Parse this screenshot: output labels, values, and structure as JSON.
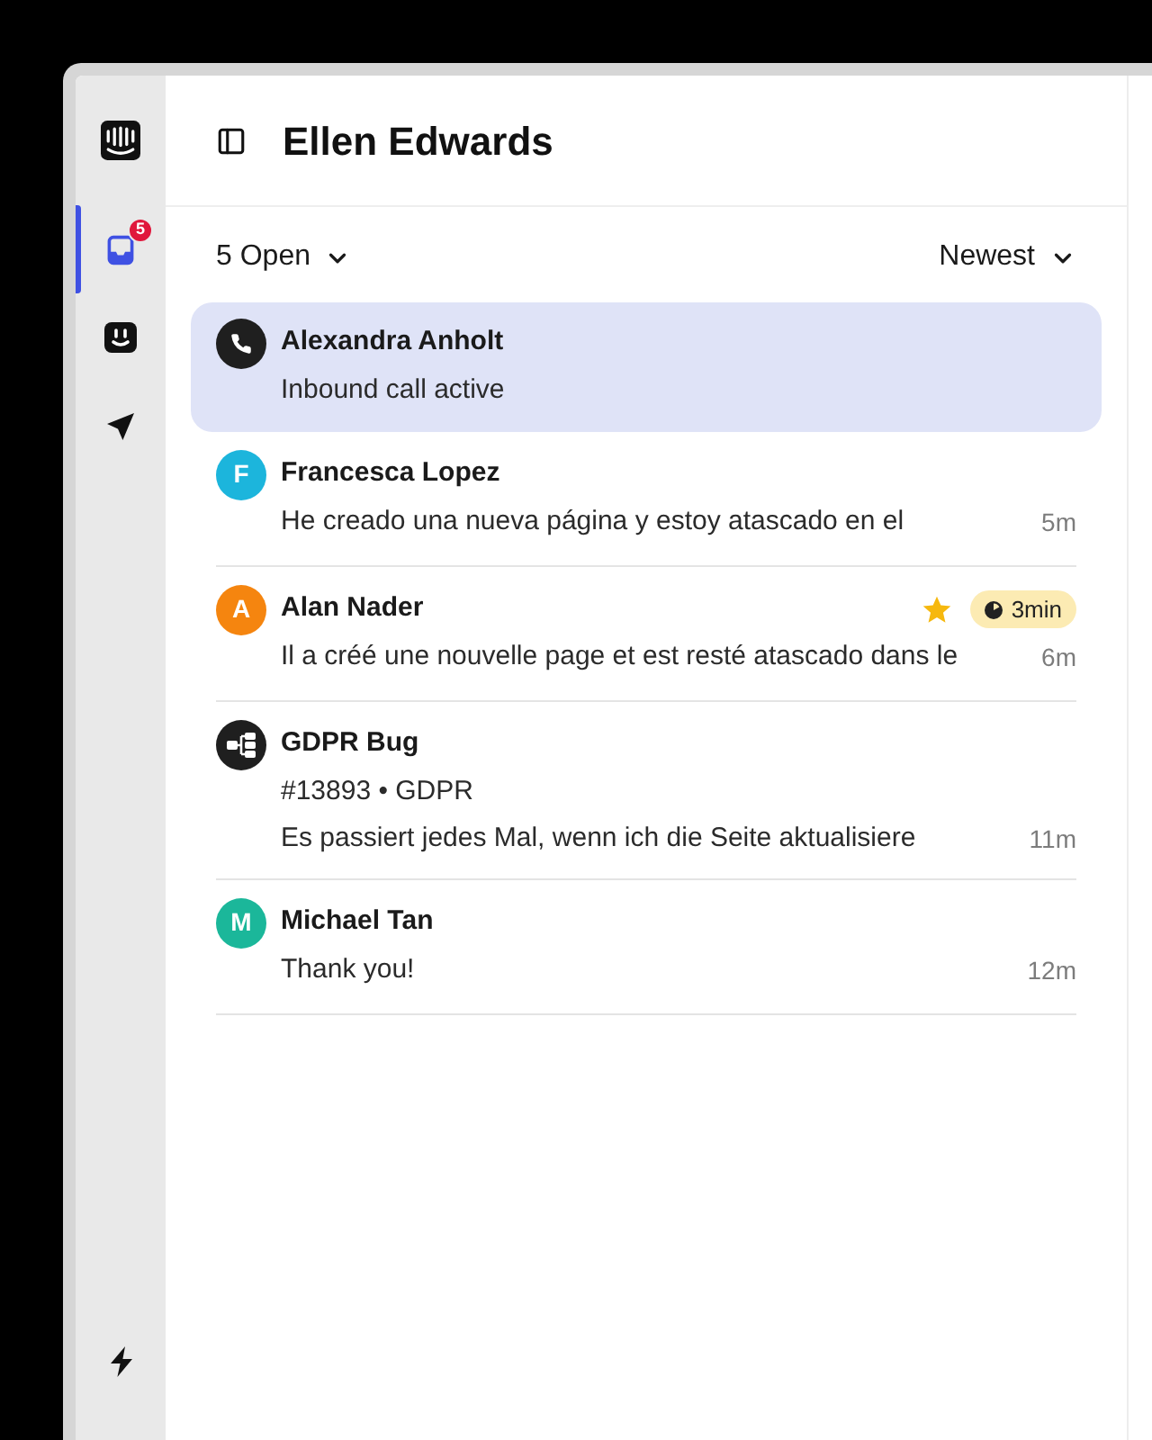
{
  "sidebar": {
    "items": [
      {
        "kind": "inbox",
        "selected": true,
        "badge": "5"
      },
      {
        "kind": "fin",
        "selected": false
      },
      {
        "kind": "send",
        "selected": false
      }
    ],
    "bottom_items": [
      {
        "kind": "bolt",
        "selected": false
      }
    ]
  },
  "header": {
    "title": "Ellen Edwards"
  },
  "filters": {
    "status": "5 Open",
    "sort": "Newest"
  },
  "conversations": [
    {
      "avatar": {
        "kind": "phone"
      },
      "name": "Alexandra Anholt",
      "starred": false,
      "lines": [
        "Inbound call active"
      ],
      "selected": true
    },
    {
      "avatar": {
        "kind": "letter",
        "letter": "F",
        "color": "#1cb5dc"
      },
      "name": "Francesca Lopez",
      "starred": false,
      "lines": [
        "He creado una nueva página y estoy atascado en el"
      ],
      "time": "5m",
      "selected": false
    },
    {
      "avatar": {
        "kind": "letter",
        "letter": "A",
        "color": "#f5850f"
      },
      "name": "Alan Nader",
      "starred": true,
      "sla": "3min",
      "lines": [
        "Il a créé une nouvelle page et est resté atascado dans le"
      ],
      "time": "6m",
      "selected": false
    },
    {
      "avatar": {
        "kind": "ticket"
      },
      "name": "GDPR Bug",
      "starred": false,
      "lines": [
        "#13893 • GDPR",
        "Es passiert jedes Mal, wenn ich die Seite aktualisiere"
      ],
      "time": "11m",
      "selected": false
    },
    {
      "avatar": {
        "kind": "letter",
        "letter": "M",
        "color": "#1bb79a"
      },
      "name": "Michael Tan",
      "starred": false,
      "lines": [
        "Thank you!"
      ],
      "time": "12m",
      "selected": false
    }
  ]
}
